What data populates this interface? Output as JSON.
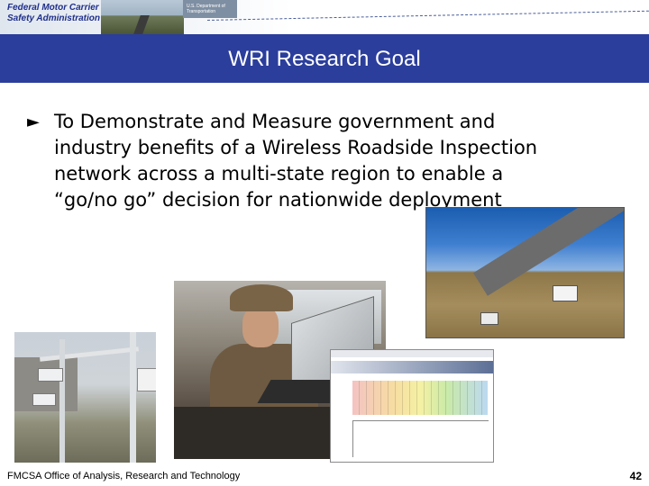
{
  "header": {
    "agency_line1": "Federal Motor Carrier",
    "agency_line2": "Safety Administration",
    "dot_line1": "U.S. Department of",
    "dot_line2": "Transportation"
  },
  "slide": {
    "title": "WRI Research Goal",
    "bullet_marker": "►",
    "bullet_line1": "To Demonstrate and Measure government and",
    "bullet_line2": "industry benefits of a Wireless Roadside Inspection",
    "bullet_line3": "network across a multi-state region to enable a",
    "bullet_line4": "“go/no go” decision for nationwide deployment"
  },
  "footer": {
    "office": "FMCSA Office of Analysis, Research and Technology",
    "page_number": "42"
  },
  "colors": {
    "title_bar": "#2b3e9c",
    "agency_text": "#1f2f8a"
  }
}
